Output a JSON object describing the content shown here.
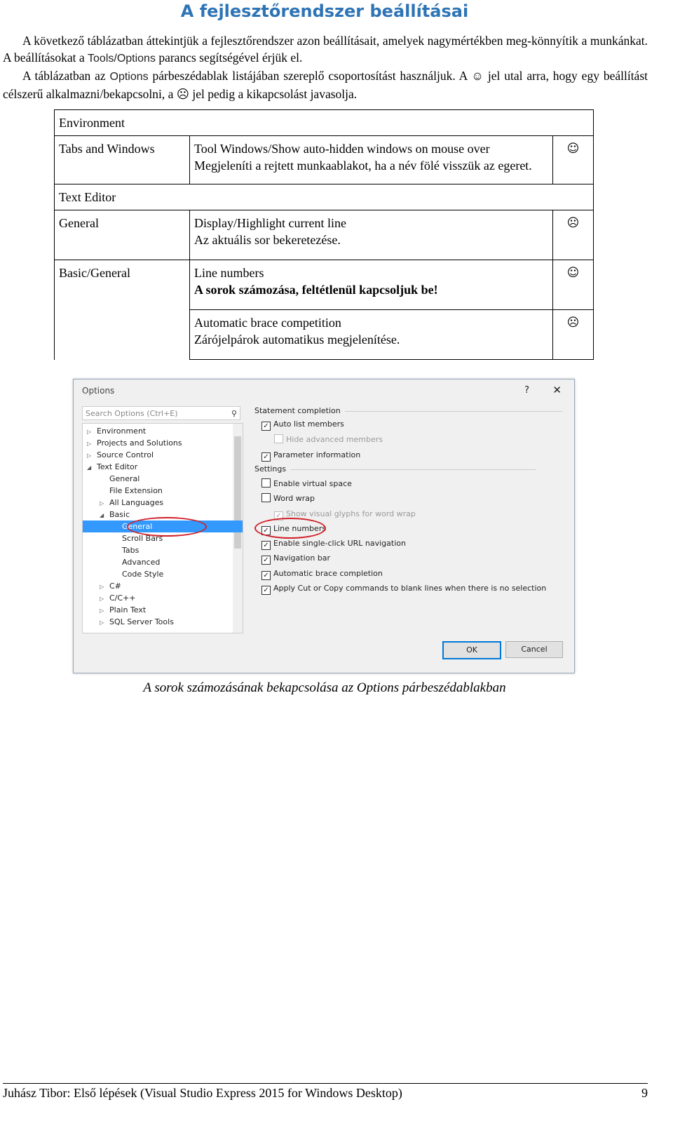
{
  "title": "A fejlesztőrendszer beállításai",
  "intro": {
    "p1a": "A következő táblázatban áttekintjük a fejlesztőrendszer azon beállításait, amelyek nagymértékben meg-könnyítik a munkánkat. A beállításokat a ",
    "p1code": "Tools/Options",
    "p1b": " parancs segítségével érjük el.",
    "p2a": "A táblázatban az ",
    "p2code": "Options",
    "p2b": " párbeszédablak listájában szereplő csoportosítást használjuk. A ☺ jel utal arra, hogy egy beállítást célszerű alkalmazni/bekapcsolni, a ☹ jel pedig a kikapcsolást javasolja."
  },
  "table": {
    "sections": [
      {
        "header": "Environment",
        "rows": [
          {
            "group": "Tabs and Windows",
            "setting": "Tool Windows/Show auto-hidden windows on mouse over",
            "desc": "Megjeleníti a rejtett munkaablakot, ha a név fölé visszük az egeret.",
            "icon": "☺",
            "bold": false
          }
        ]
      },
      {
        "header": "Text Editor",
        "rows": [
          {
            "group": "General",
            "setting": "Display/Highlight current line",
            "desc": "Az aktuális sor bekeretezése.",
            "icon": "☹",
            "bold": false
          },
          {
            "group": "Basic/General",
            "setting": "Line numbers",
            "desc": "A sorok számozása, feltétlenül kapcsoljuk be!",
            "icon": "☺",
            "bold": true
          },
          {
            "group": "",
            "setting": "Automatic brace competition",
            "desc": "Zárójelpárok automatikus megjelenítése.",
            "icon": "☹",
            "bold": false
          }
        ]
      }
    ]
  },
  "dialog": {
    "title": "Options",
    "help": "?",
    "close": "✕",
    "search_placeholder": "Search Options (Ctrl+E)",
    "tree": [
      {
        "label": "Environment",
        "arrow": "▷",
        "level": 0
      },
      {
        "label": "Projects and Solutions",
        "arrow": "▷",
        "level": 0
      },
      {
        "label": "Source Control",
        "arrow": "▷",
        "level": 0
      },
      {
        "label": "Text Editor",
        "arrow": "◢",
        "level": 0
      },
      {
        "label": "General",
        "arrow": "",
        "level": 1
      },
      {
        "label": "File Extension",
        "arrow": "",
        "level": 1
      },
      {
        "label": "All Languages",
        "arrow": "▷",
        "level": 1
      },
      {
        "label": "Basic",
        "arrow": "◢",
        "level": 1
      },
      {
        "label": "General",
        "arrow": "",
        "level": 2,
        "selected": true
      },
      {
        "label": "Scroll Bars",
        "arrow": "",
        "level": 2
      },
      {
        "label": "Tabs",
        "arrow": "",
        "level": 2
      },
      {
        "label": "Advanced",
        "arrow": "",
        "level": 2
      },
      {
        "label": "Code Style",
        "arrow": "",
        "level": 2
      },
      {
        "label": "C#",
        "arrow": "▷",
        "level": 1
      },
      {
        "label": "C/C++",
        "arrow": "▷",
        "level": 1
      },
      {
        "label": "Plain Text",
        "arrow": "▷",
        "level": 1
      },
      {
        "label": "SQL Server Tools",
        "arrow": "▷",
        "level": 1
      }
    ],
    "groups": {
      "statement": "Statement completion",
      "settings": "Settings"
    },
    "options": [
      {
        "label": "Auto list members",
        "checked": true,
        "indent": 0,
        "disabled": false
      },
      {
        "label": "Hide advanced members",
        "checked": false,
        "indent": 1,
        "disabled": true
      },
      {
        "label": "Parameter information",
        "checked": true,
        "indent": 0,
        "disabled": false
      },
      {
        "label": "Enable virtual space",
        "checked": false,
        "indent": 0,
        "disabled": false
      },
      {
        "label": "Word wrap",
        "checked": false,
        "indent": 0,
        "disabled": false
      },
      {
        "label": "Show visual glyphs for word wrap",
        "checked": true,
        "indent": 1,
        "disabled": true
      },
      {
        "label": "Line numbers",
        "checked": true,
        "indent": 0,
        "disabled": false
      },
      {
        "label": "Enable single-click URL navigation",
        "checked": true,
        "indent": 0,
        "disabled": false
      },
      {
        "label": "Navigation bar",
        "checked": true,
        "indent": 0,
        "disabled": false
      },
      {
        "label": "Automatic brace completion",
        "checked": true,
        "indent": 0,
        "disabled": false
      },
      {
        "label": "Apply Cut or Copy commands to blank lines when there is no selection",
        "checked": true,
        "indent": 0,
        "disabled": false
      }
    ],
    "ok": "OK",
    "cancel": "Cancel",
    "highlight_color": "#d0202a",
    "selection_color": "#3399ff"
  },
  "caption": "A sorok számozásának bekapcsolása az Options párbeszédablakban",
  "footer": {
    "text": "Juhász Tibor: Első lépések (Visual Studio Express 2015 for Windows Desktop)",
    "page": "9"
  }
}
